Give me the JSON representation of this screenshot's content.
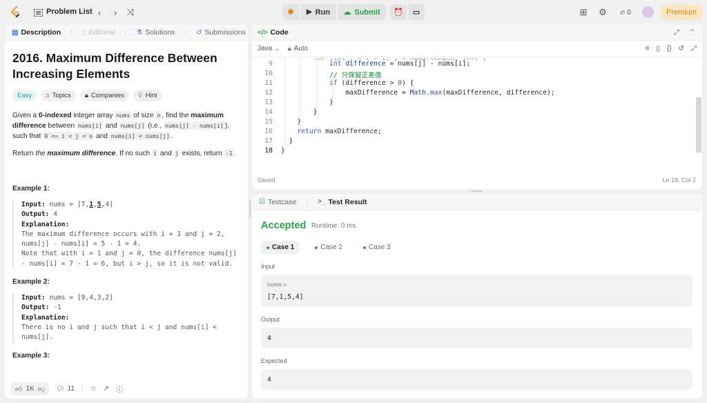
{
  "nav": {
    "problem_list": "Problem List",
    "run": "Run",
    "submit": "Submit",
    "fire_count": "0",
    "premium": "Premium"
  },
  "left": {
    "tabs": [
      "Description",
      "Editorial",
      "Solutions",
      "Submissions"
    ],
    "title": "2016. Maximum Difference Between Increasing Elements",
    "chips": [
      "Easy",
      "Topics",
      "Companies",
      "Hint"
    ],
    "likes": "1K",
    "comments": "11",
    "example1_heading": "Example 1:",
    "example2_heading": "Example 2:",
    "example3_heading": "Example 3:"
  },
  "code": {
    "tab_label": "Code",
    "language": "Java",
    "mode": "Auto",
    "saved": "Saved",
    "cursor": "Ln 18, Col 2"
  },
  "result": {
    "tabs": [
      "Testcase",
      "Test Result"
    ],
    "status": "Accepted",
    "runtime": "Runtime: 0 ms",
    "cases": [
      "Case 1",
      "Case 2",
      "Case 3"
    ],
    "input_label": "Input",
    "input_name": "nums =",
    "input_value": "[7,1,5,4]",
    "output_label": "Output",
    "output_value": "4",
    "expected_label": "Expected",
    "expected_value": "4"
  },
  "colors": {
    "accepted": "#2aa14a",
    "accent_blue": "#3b48d6",
    "comment": "#0f8a2f",
    "premium": "#e08600"
  }
}
